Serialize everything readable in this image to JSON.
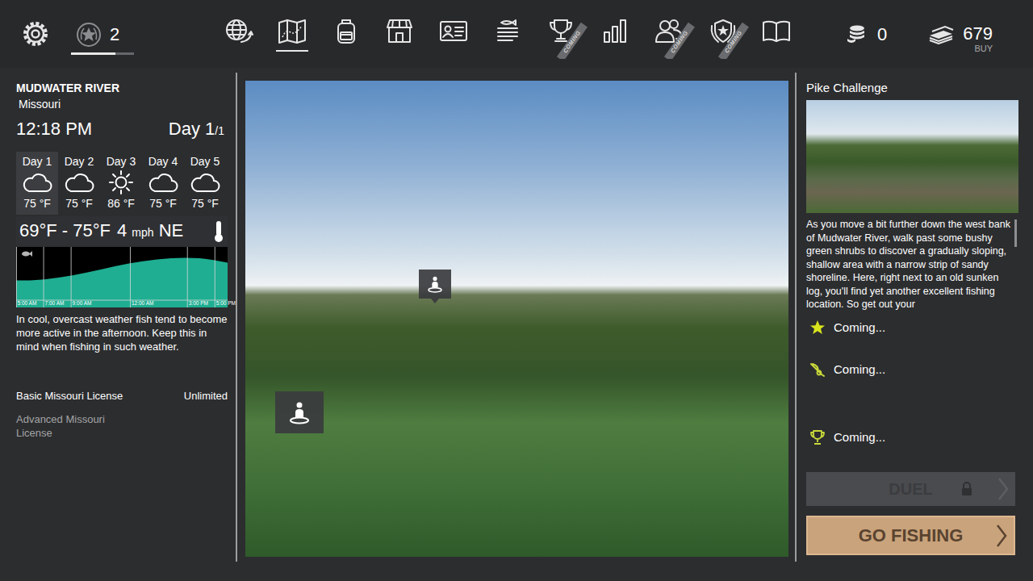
{
  "topbar": {
    "level": "2",
    "level_progress": {
      "level": 0.7
    },
    "nav": [
      {
        "selected": false
      },
      {
        "selected": true
      },
      {
        "selected": false
      },
      {
        "selected": false
      },
      {
        "selected": false
      },
      {
        "selected": false
      },
      {
        "selected": false,
        "badge": "COMING"
      },
      {
        "selected": false
      },
      {
        "selected": false,
        "badge": "COMING"
      },
      {
        "selected": false,
        "badge": "COMING"
      },
      {
        "selected": false
      }
    ],
    "coins": "0",
    "money": "679",
    "buy": "BUY"
  },
  "location": {
    "name": "MUDWATER RIVER",
    "region": "Missouri",
    "time": "12:18 PM",
    "day": "Day 1",
    "day_total": "/1"
  },
  "forecast": [
    {
      "label": "Day 1",
      "kind": "cloud",
      "temp": "75 °F",
      "selected": true
    },
    {
      "label": "Day 2",
      "kind": "cloud",
      "temp": "75 °F",
      "selected": false
    },
    {
      "label": "Day 3",
      "kind": "sun",
      "temp": "86 °F",
      "selected": false
    },
    {
      "label": "Day 4",
      "kind": "cloud",
      "temp": "75 °F",
      "selected": false
    },
    {
      "label": "Day 5",
      "kind": "cloud",
      "temp": "75 °F",
      "selected": false
    }
  ],
  "conditions": {
    "temp_range": "69°F - 75°F",
    "wind_speed": "4",
    "wind_unit": "mph",
    "wind_dir": "NE"
  },
  "activity_chart": {
    "values": [
      44,
      44,
      46,
      50,
      55,
      61,
      68,
      75,
      81,
      86,
      90,
      93,
      94,
      93,
      89,
      83
    ],
    "ticks": [
      "5:00 AM",
      "7:00 AM",
      "9:00 AM",
      "12:00 AM",
      "3:00 PM",
      "5:00 PM"
    ]
  },
  "tip": "In cool, overcast weather fish tend to become more active in the afternoon. Keep this in mind when fishing in such weather.",
  "licenses": [
    {
      "name": "Basic Missouri License",
      "value": "Unlimited",
      "disabled": false
    },
    {
      "name": "Advanced Missouri License",
      "disabled": true
    }
  ],
  "challenge": {
    "title": "Pike Challenge",
    "description": "As you move a bit further down the west bank of Mudwater River, walk past some bushy green shrubs to discover a gradually sloping, shallow area with a narrow strip of sandy shoreline. Here, right next to an old sunken log, you'll find yet another excellent fishing location. So get out your",
    "scrollbar": {
      "level": 0.3
    },
    "rewards": [
      {
        "kind": "star",
        "text": "Coming..."
      },
      {
        "kind": "rod",
        "text": "Coming..."
      },
      {
        "kind": "trophy",
        "text": "Coming..."
      }
    ]
  },
  "buttons": [
    {
      "label": "DUEL",
      "disabled": true,
      "locked": true
    },
    {
      "label": "GO FISHING",
      "disabled": false
    }
  ]
}
